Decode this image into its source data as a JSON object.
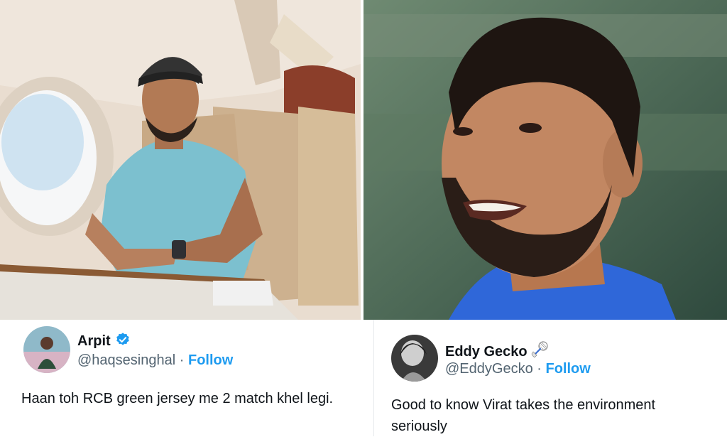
{
  "tweets": [
    {
      "name": "Arpit",
      "handle": "@haqsesinghal",
      "separator": "·",
      "follow_label": "Follow",
      "text": "Haan toh RCB green jersey me 2 match khel legi.",
      "verified": true,
      "badge_icon": "verified-badge-icon"
    },
    {
      "name": "Eddy Gecko",
      "handle": "@EddyGecko",
      "separator": "·",
      "follow_label": "Follow",
      "text": "Good to know Virat takes the environment seriously",
      "verified": false,
      "badge_icon": "badminton-emoji-icon"
    }
  ],
  "colors": {
    "follow": "#1d9bf0",
    "handle": "#536471",
    "text": "#0f1419",
    "verified": "#1d9bf0"
  }
}
